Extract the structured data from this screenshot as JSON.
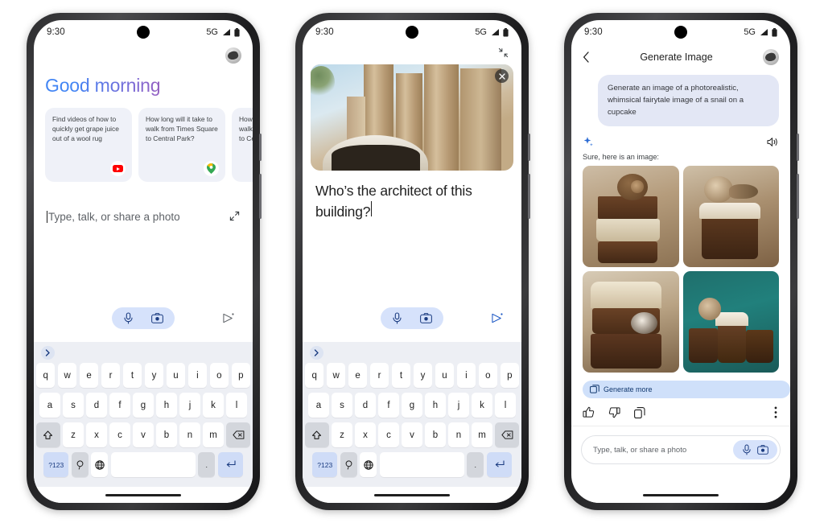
{
  "statusbar": {
    "time": "9:30",
    "network": "5G"
  },
  "phone1": {
    "greeting": "Good morning",
    "cards": [
      {
        "text": "Find videos of how to quickly get grape juice out of a wool rug",
        "badge": "youtube-icon"
      },
      {
        "text": "How long will it take to walk from Times Square to Central Park?",
        "badge": "maps-pin-icon"
      },
      {
        "text": "How long will it take to walk from Times Square to Central Park?",
        "badge": ""
      }
    ],
    "composer_placeholder": "Type, talk, or share a photo",
    "expand_label": "expand",
    "mic_label": "mic",
    "camera_label": "camera",
    "send_label": "send"
  },
  "phone2": {
    "collapse_label": "collapse",
    "photo_alt": "Sagrada Familia facade",
    "close_label": "remove image",
    "typed_text": "Who’s the architect of this building?",
    "mic_label": "mic",
    "camera_label": "camera",
    "send_label": "send"
  },
  "phone3": {
    "back_label": "back",
    "title": "Generate Image",
    "prompt": "Generate an image of a photorealistic, whimsical fairytale image of a snail on a cupcake",
    "lead": "Sure, here is an image:",
    "sparkle_label": "gemini-sparkle",
    "speaker_label": "read aloud",
    "images": [
      {
        "alt": "snail on stacked cupcakes"
      },
      {
        "alt": "snail on sprinkled cupcake"
      },
      {
        "alt": "snail beside frosted cupcakes"
      },
      {
        "alt": "snail on cupcakes teal background"
      }
    ],
    "generate_more_label": "Generate more",
    "thumbs_up_label": "thumbs up",
    "thumbs_down_label": "thumbs down",
    "copy_label": "copy",
    "more_label": "more options",
    "input_placeholder": "Type, talk, or share a photo",
    "mic_label": "mic",
    "camera_label": "camera"
  },
  "keyboard": {
    "row1": [
      "q",
      "w",
      "e",
      "r",
      "t",
      "y",
      "u",
      "i",
      "o",
      "p"
    ],
    "row2": [
      "a",
      "s",
      "d",
      "f",
      "g",
      "h",
      "j",
      "k",
      "l"
    ],
    "row3": [
      "z",
      "x",
      "c",
      "v",
      "b",
      "n",
      "m"
    ],
    "shift": "shift",
    "backspace": "backspace",
    "numbers": "?123",
    "emoji": "emoji",
    "globe": "language",
    "space": "space",
    "period": ".",
    "enter": "enter",
    "suggestion_chevron": "expand suggestions"
  },
  "colors": {
    "accent_blue": "#4285F4",
    "chip_blue": "#cfe0fa",
    "card_bg": "#eff1f8",
    "bubble_bg": "#e3e7f5"
  }
}
